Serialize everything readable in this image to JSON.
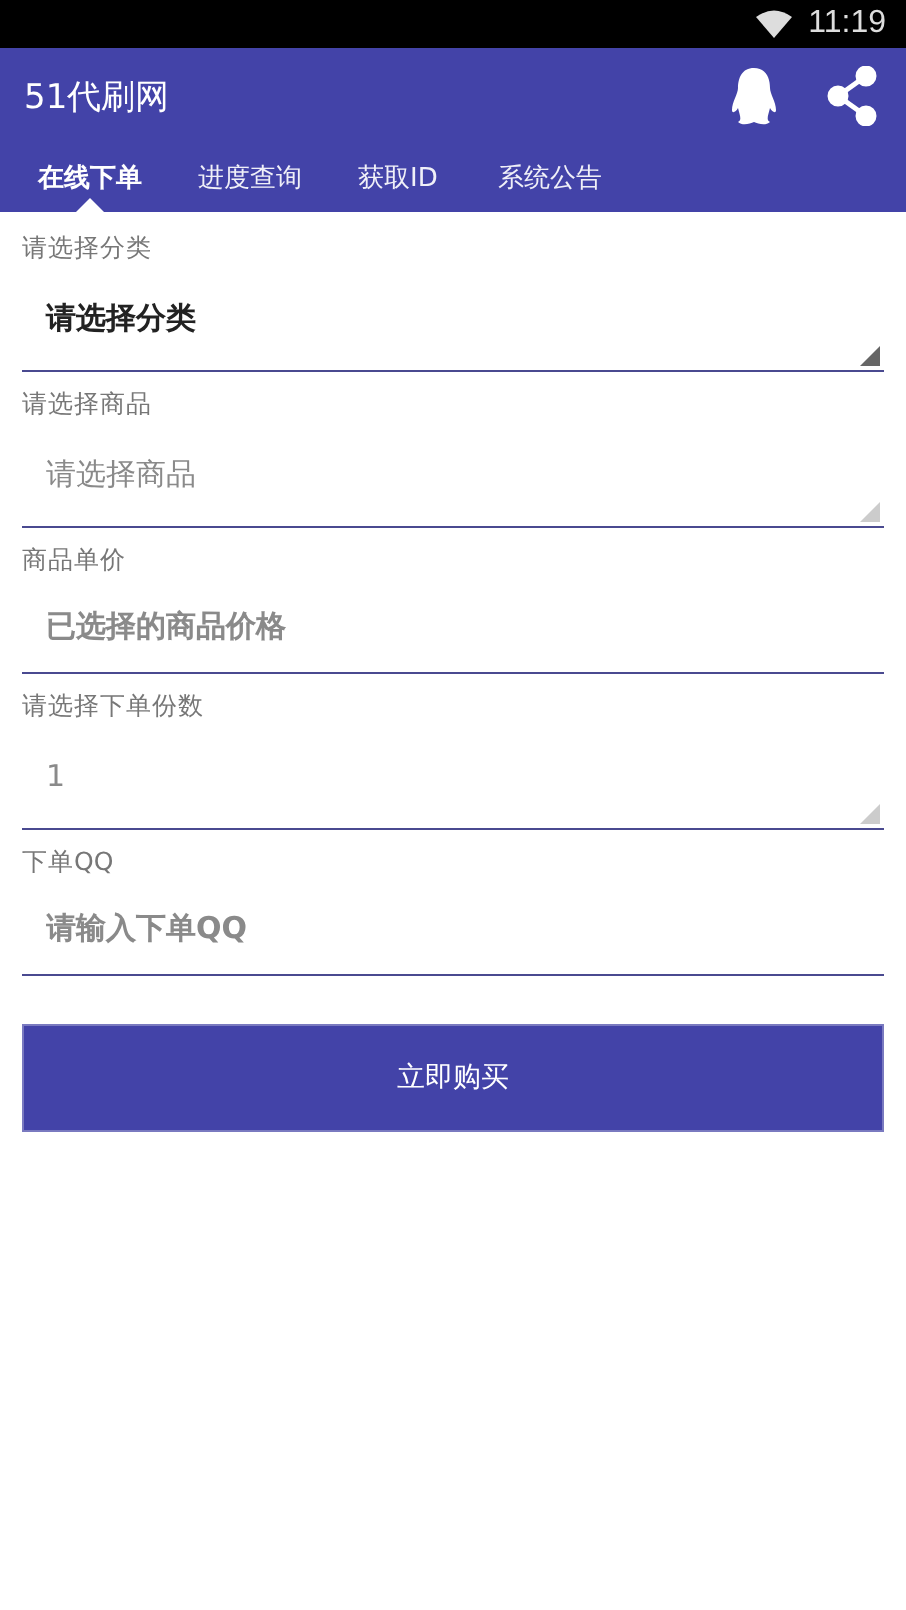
{
  "status_bar": {
    "time": "11:19"
  },
  "app_bar": {
    "title": "51代刷网"
  },
  "tabs": [
    {
      "label": "在线下单",
      "selected": true
    },
    {
      "label": "进度查询",
      "selected": false
    },
    {
      "label": "获取ID",
      "selected": false
    },
    {
      "label": "系统公告",
      "selected": false
    }
  ],
  "form": [
    {
      "kind": "spinner",
      "label": "请选择分类",
      "value": "请选择分类",
      "disabled": false
    },
    {
      "kind": "spinner",
      "label": "请选择商品",
      "value": "请选择商品",
      "disabled": true
    },
    {
      "kind": "input",
      "label": "商品单价",
      "placeholder": "已选择的商品价格"
    },
    {
      "kind": "spinner",
      "label": "请选择下单份数",
      "value": "1",
      "disabled": true
    },
    {
      "kind": "input",
      "label": "下单QQ",
      "placeholder": "请输入下单QQ"
    }
  ],
  "submit_button": "立即购买"
}
